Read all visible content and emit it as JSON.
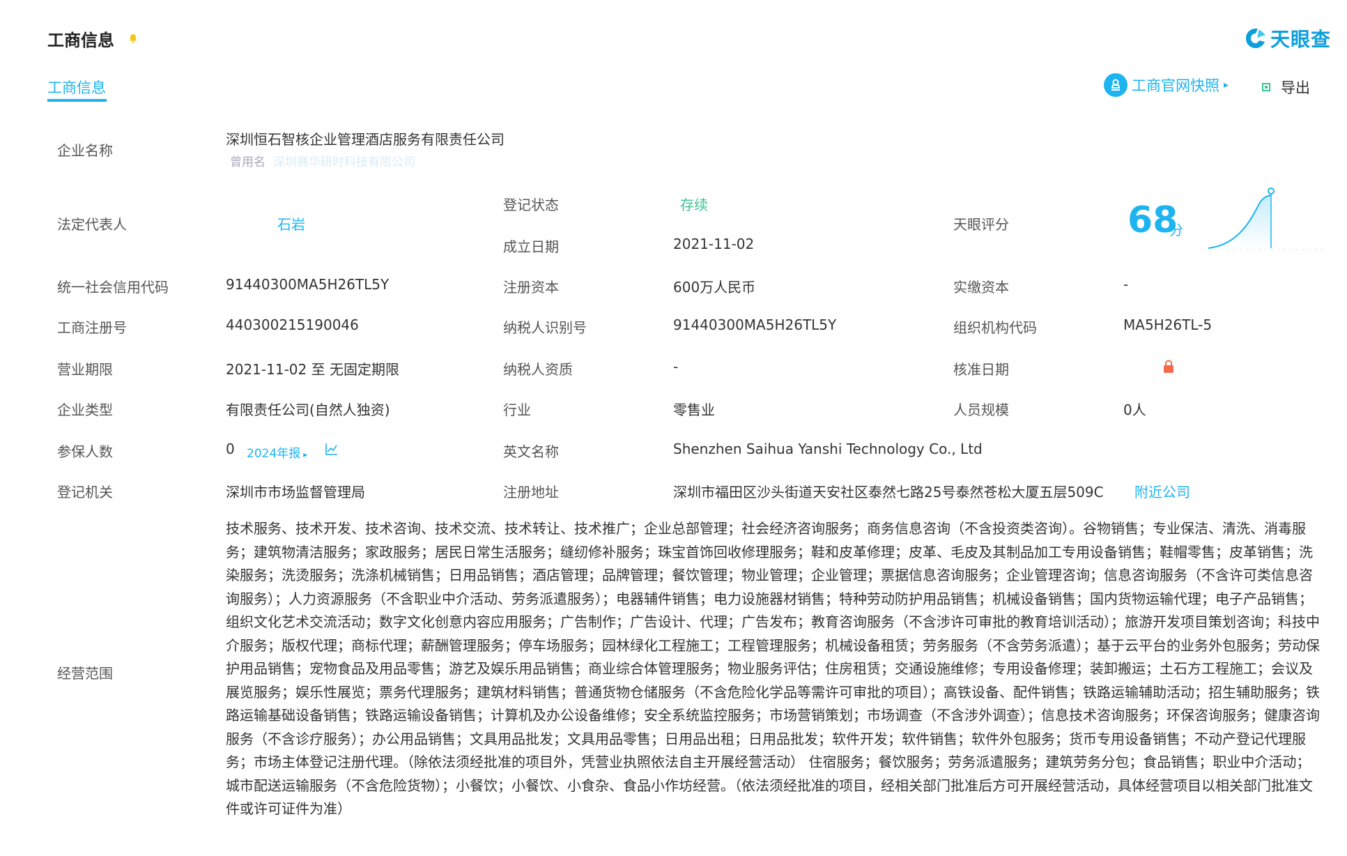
{
  "header": {
    "title": "工商信息",
    "logo_text": "天眼查",
    "tab_label": "工商信息",
    "snapshot_label": "工商官网快照",
    "export_label": "导出"
  },
  "colors": {
    "accent": "#1db4f0",
    "status_green": "#3cc18f",
    "bell": "#f5c518",
    "lock": "#f56a4a"
  },
  "company": {
    "name_label": "企业名称",
    "name_value": "深圳恒石智核企业管理酒店服务有限责任公司",
    "former_label": "曾用名",
    "former_value": "深圳赛华研时科技有限公司"
  },
  "rows": {
    "legal_rep_label": "法定代表人",
    "legal_rep_value": "石岩",
    "status_label": "登记状态",
    "status_value": "存续",
    "found_label": "成立日期",
    "found_value": "2021-11-02",
    "score_label": "天眼评分",
    "score_value": "68",
    "score_unit": "分",
    "credit_label": "统一社会信用代码",
    "credit_value": "91440300MA5H26TL5Y",
    "capital_label": "注册资本",
    "capital_value": "600万人民币",
    "paid_label": "实缴资本",
    "paid_value": "-",
    "regno_label": "工商注册号",
    "regno_value": "440300215190046",
    "taxid_label": "纳税人识别号",
    "taxid_value": "91440300MA5H26TL5Y",
    "org_label": "组织机构代码",
    "org_value": "MA5H26TL-5",
    "term_label": "营业期限",
    "term_value": "2021-11-02 至 无固定期限",
    "taxq_label": "纳税人资质",
    "taxq_value": "-",
    "approve_label": "核准日期",
    "type_label": "企业类型",
    "type_value": "有限责任公司(自然人独资)",
    "industry_label": "行业",
    "industry_value": "零售业",
    "staff_label": "人员规模",
    "staff_value": "0人",
    "insured_label": "参保人数",
    "insured_value": "0",
    "report_label": "2024年报",
    "en_label": "英文名称",
    "en_value": "Shenzhen Saihua Yanshi Technology Co., Ltd",
    "authority_label": "登记机关",
    "authority_value": "深圳市市场监督管理局",
    "addr_label": "注册地址",
    "addr_value": "深圳市福田区沙头街道天安社区泰然七路25号泰然苍松大厦五层509C",
    "nearby_label": "附近公司"
  },
  "scope": {
    "label": "经营范围",
    "text": "技术服务、技术开发、技术咨询、技术交流、技术转让、技术推广；企业总部管理；社会经济咨询服务；商务信息咨询（不含投资类咨询）。谷物销售；专业保洁、清洗、消毒服务；建筑物清洁服务；家政服务；居民日常生活服务；缝纫修补服务；珠宝首饰回收修理服务；鞋和皮革修理；皮革、毛皮及其制品加工专用设备销售；鞋帽零售；皮革销售；洗染服务；洗烫服务；洗涤机械销售；日用品销售；酒店管理；品牌管理；餐饮管理；物业管理；企业管理；票据信息咨询服务；企业管理咨询；信息咨询服务（不含许可类信息咨询服务）；人力资源服务（不含职业中介活动、劳务派遣服务）；电器辅件销售；电力设施器材销售；特种劳动防护用品销售；机械设备销售；国内货物运输代理；电子产品销售；组织文化艺术交流活动；数字文化创意内容应用服务；广告制作；广告设计、代理；广告发布；教育咨询服务（不含涉许可审批的教育培训活动）；旅游开发项目策划咨询；科技中介服务；版权代理；商标代理；薪酬管理服务；停车场服务；园林绿化工程施工；工程管理服务；机械设备租赁；劳务服务（不含劳务派遣）；基于云平台的业务外包服务；劳动保护用品销售；宠物食品及用品零售；游艺及娱乐用品销售；商业综合体管理服务；物业服务评估；住房租赁；交通设施维修；专用设备修理；装卸搬运；土石方工程施工；会议及展览服务；娱乐性展览；票务代理服务；建筑材料销售；普通货物仓储服务（不含危险化学品等需许可审批的项目）；高铁设备、配件销售；铁路运输辅助活动；招生辅助服务；铁路运输基础设备销售；铁路运输设备销售；计算机及办公设备维修；安全系统监控服务；市场营销策划；市场调查（不含涉外调查）；信息技术咨询服务；环保咨询服务；健康咨询服务（不含诊疗服务）；办公用品销售；文具用品批发；文具用品零售；日用品出租；日用品批发；软件开发；软件销售；软件外包服务；货币专用设备销售；不动产登记代理服务；市场主体登记注册代理。（除依法须经批准的项目外，凭营业执照依法自主开展经营活动） 住宿服务；餐饮服务；劳务派遣服务；建筑劳务分包；食品销售；职业中介活动；城市配送运输服务（不含危险货物）；小餐饮；小餐饮、小食杂、食品小作坊经营。（依法须经批准的项目，经相关部门批准后方可开展经营活动，具体经营项目以相关部门批准文件或许可证件为准）"
  }
}
